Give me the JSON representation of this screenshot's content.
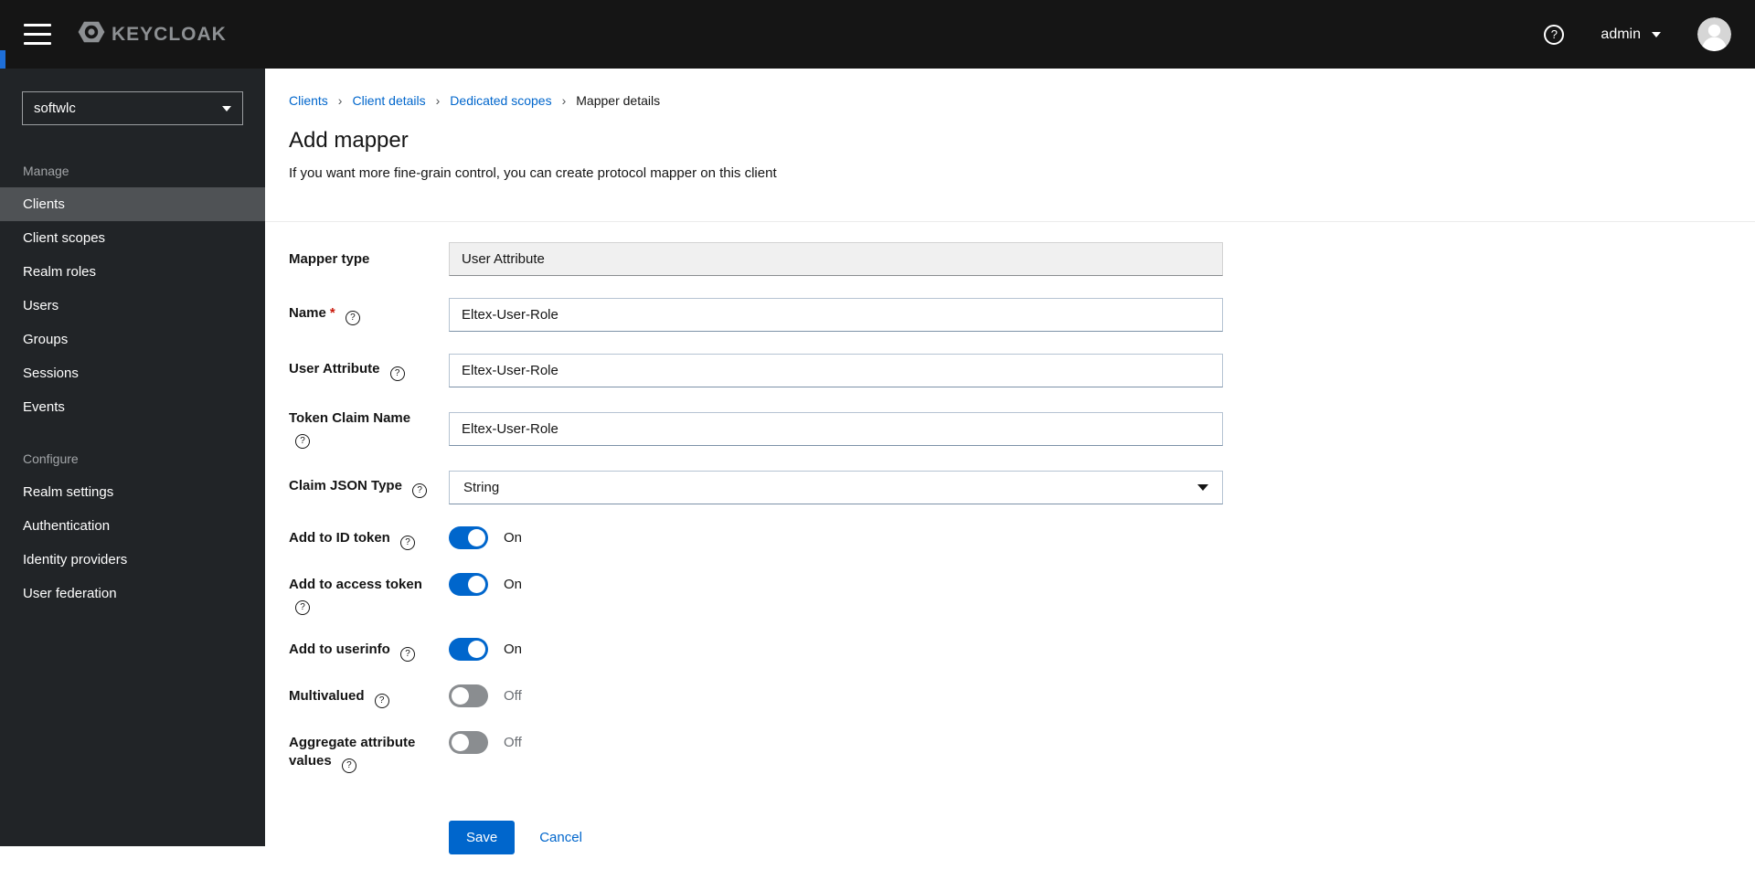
{
  "masthead": {
    "brand": "KEYCLOAK",
    "user": {
      "name": "admin"
    }
  },
  "sidebar": {
    "realm": "softwlc",
    "active_item": "Clients",
    "groups": [
      {
        "label": "Manage",
        "items": [
          "Clients",
          "Client scopes",
          "Realm roles",
          "Users",
          "Groups",
          "Sessions",
          "Events"
        ]
      },
      {
        "label": "Configure",
        "items": [
          "Realm settings",
          "Authentication",
          "Identity providers",
          "User federation"
        ]
      }
    ]
  },
  "breadcrumb": [
    "Clients",
    "Client details",
    "Dedicated scopes",
    "Mapper details"
  ],
  "page": {
    "title": "Add mapper",
    "description": "If you want more fine-grain control, you can create protocol mapper on this client"
  },
  "form": {
    "required_indicator": "*",
    "fields": {
      "mapper_type": {
        "label": "Mapper type",
        "value": "User Attribute",
        "readonly": true
      },
      "name": {
        "label": "Name",
        "value": "Eltex-User-Role",
        "required": true
      },
      "user_attribute": {
        "label": "User Attribute",
        "value": "Eltex-User-Role"
      },
      "token_claim_name": {
        "label": "Token Claim Name",
        "value": "Eltex-User-Role"
      },
      "claim_json_type": {
        "label": "Claim JSON Type",
        "value": "String"
      }
    },
    "switches": {
      "add_to_id_token": {
        "label": "Add to ID token",
        "state": "On"
      },
      "add_to_access_token": {
        "label": "Add to access token",
        "state": "On"
      },
      "add_to_userinfo": {
        "label": "Add to userinfo",
        "state": "On"
      },
      "multivalued": {
        "label": "Multivalued",
        "state": "Off"
      },
      "aggregate_attribute_values": {
        "label": "Aggregate attribute values",
        "state": "Off"
      }
    },
    "actions": {
      "save": "Save",
      "cancel": "Cancel"
    }
  },
  "icons": {
    "help_glyph": "?",
    "breadcrumb_separator": "›"
  },
  "colors": {
    "accent": "#0066cc",
    "masthead_bg": "#151515",
    "sidebar_bg": "#212427",
    "active_nav_bg": "#4f5255",
    "switch_on": "#0066cc",
    "switch_off": "#8a8d90",
    "required": "#c9190b",
    "link": "#0066cc"
  }
}
